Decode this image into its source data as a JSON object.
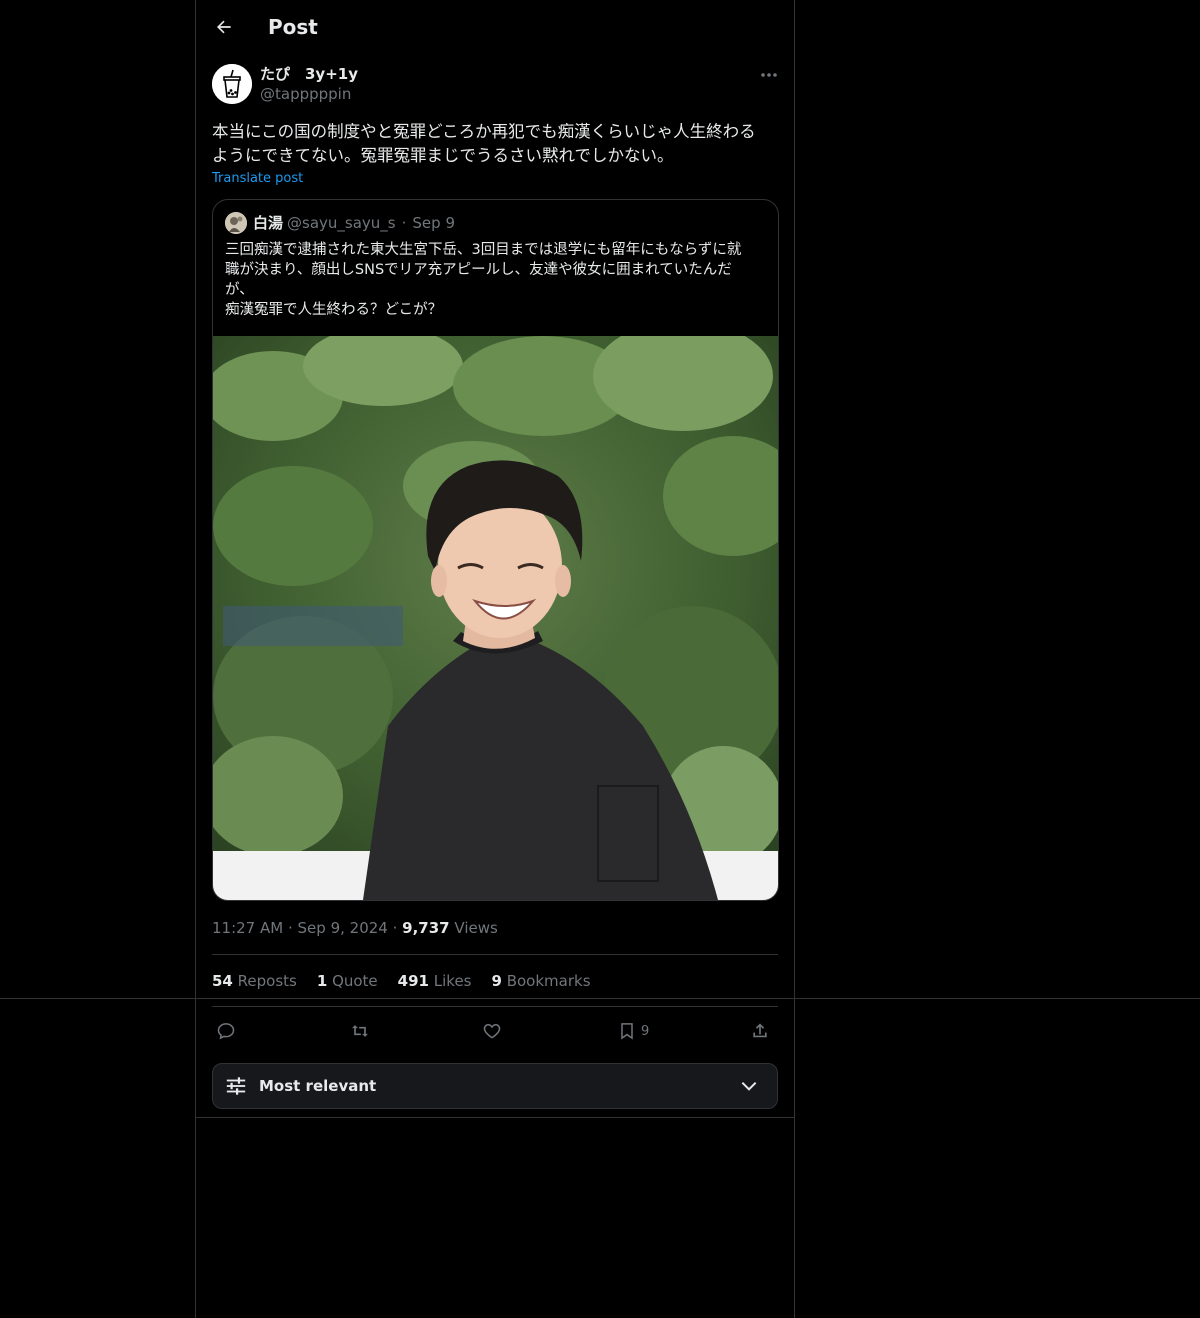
{
  "header": {
    "title": "Post"
  },
  "post": {
    "display_name": "たぴ　3y+1y",
    "handle": "@tapppppin",
    "text": "本当にこの国の制度やと冤罪どころか再犯でも痴漢くらいじゃ人生終わる\nようにできてない。冤罪冤罪まじでうるさい黙れでしかない。",
    "translate_label": "Translate post",
    "time": "11:27 AM",
    "date": "Sep 9, 2024",
    "views_count": "9,737",
    "views_label": "Views"
  },
  "quote": {
    "display_name": "白湯",
    "handle": "@sayu_sayu_s",
    "dot": "·",
    "date": "Sep 9",
    "text": "三回痴漢で逮捕された東大生宮下岳、3回目までは退学にも留年にもならずに就\n職が決まり、顔出しSNSでリア充アピールし、友達や彼女に囲まれていたんだ\nが、\n痴漢冤罪で人生終わる？どこが？"
  },
  "stats": {
    "reposts_count": "54",
    "reposts_label": "Reposts",
    "quote_count": "1",
    "quote_label": "Quote",
    "likes_count": "491",
    "likes_label": "Likes",
    "bookmarks_count": "9",
    "bookmarks_label": "Bookmarks"
  },
  "actions": {
    "bookmark_count": "9",
    "icons": [
      "reply-icon",
      "repost-icon",
      "like-icon",
      "bookmark-icon",
      "share-icon"
    ]
  },
  "sort": {
    "label": "Most relevant"
  },
  "colors": {
    "background": "#000000",
    "text": "#e7e9ea",
    "muted": "#71767b",
    "link": "#1d9bf0",
    "border": "#2f3336"
  }
}
